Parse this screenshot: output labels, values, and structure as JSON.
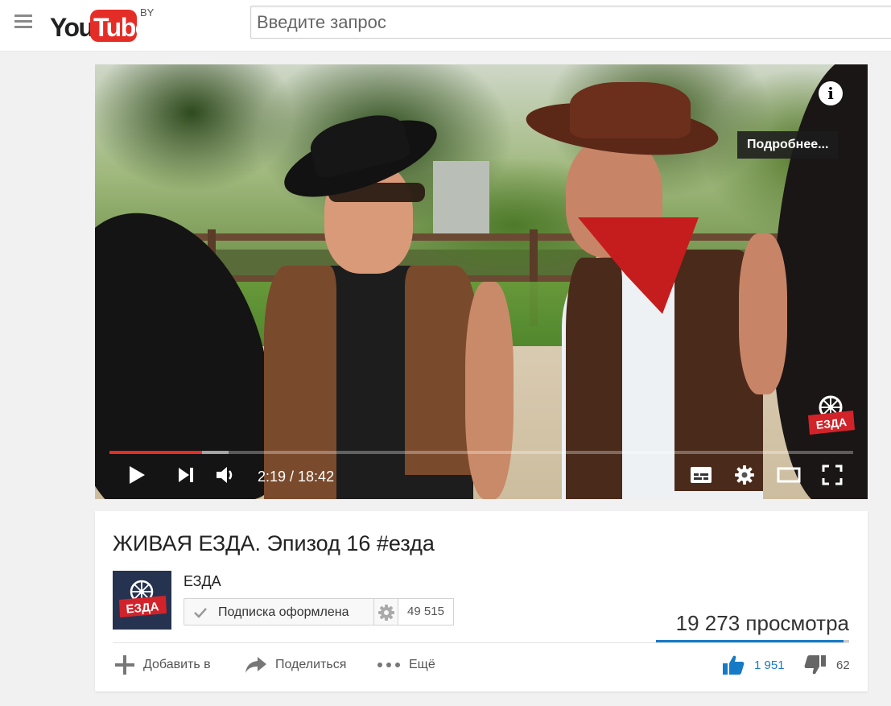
{
  "masthead": {
    "logo_you": "You",
    "logo_tube": "Tube",
    "region": "BY",
    "search_placeholder": "Введите запрос"
  },
  "player": {
    "more_card": "Подробнее...",
    "time_display": "2:19 / 18:42",
    "progress_played_fraction": 0.124,
    "progress_loaded_fraction": 0.16,
    "watermark_text": "ЕЗДА"
  },
  "video": {
    "title": "ЖИВАЯ ЕЗДА. Эпизод 16 #езда",
    "channel_name": "ЕЗДА",
    "channel_avatar_text": "ЕЗДА",
    "subscribe_label": "Подписка оформлена",
    "subscriber_count": "49 515",
    "views": "19 273 просмотра",
    "like_fraction": 0.969,
    "likes": "1 951",
    "dislikes": "62"
  },
  "actions": {
    "add_label": "Добавить в",
    "share_label": "Поделиться",
    "more_label": "Ещё"
  },
  "colors": {
    "brand_red": "#e52d27",
    "like_blue": "#167ac6"
  }
}
